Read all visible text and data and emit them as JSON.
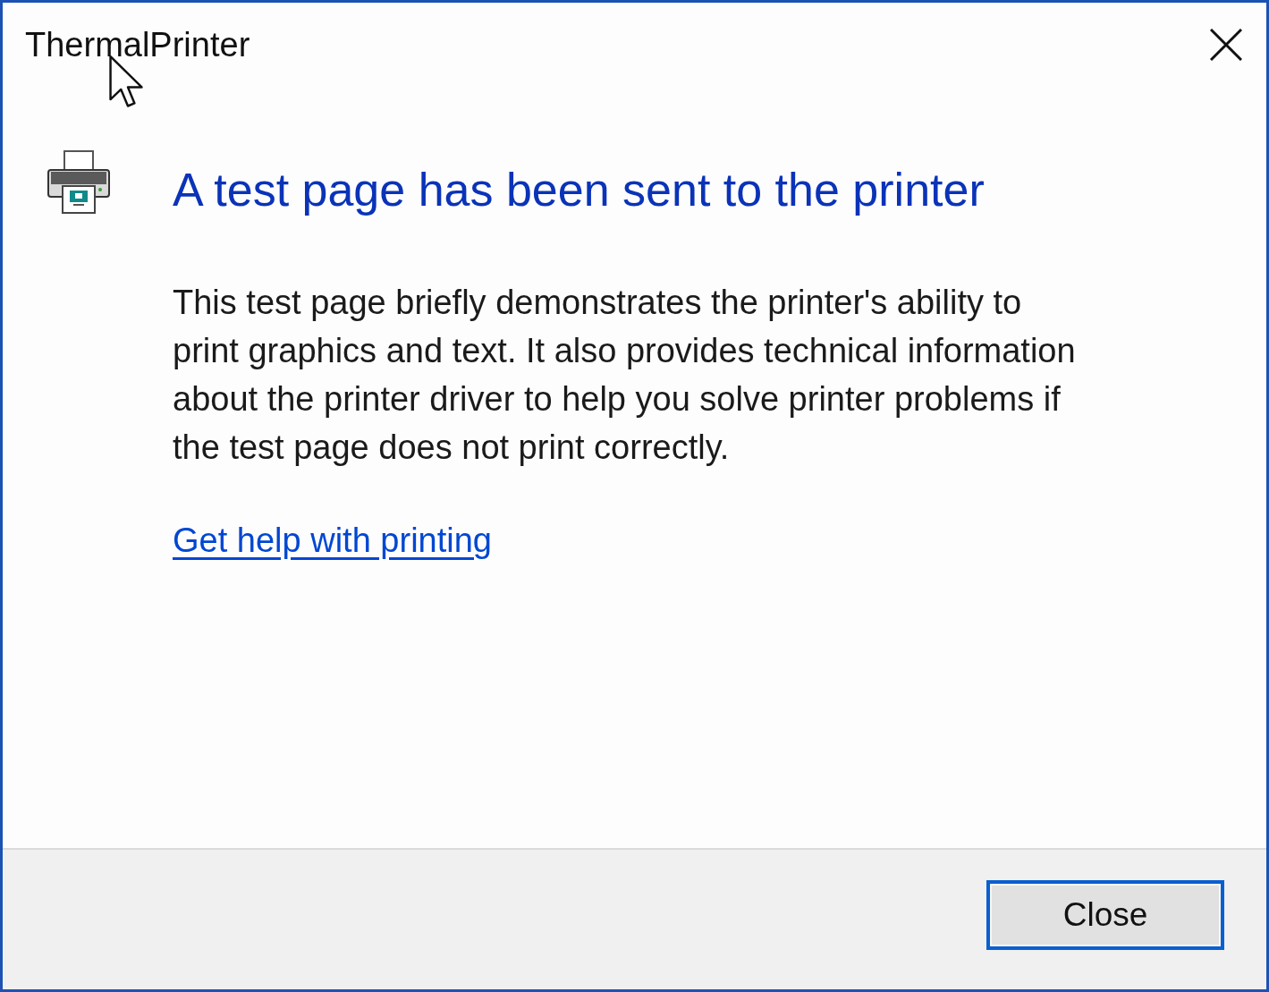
{
  "window": {
    "title": "ThermalPrinter"
  },
  "heading": "A test page has been sent to the printer",
  "body": "This test page briefly demonstrates the printer's ability to print graphics and text. It also provides technical information about the printer driver to help you solve printer problems if the test page does not print correctly.",
  "link": "Get help with printing",
  "buttons": [
    {
      "label": "Close",
      "focused": true
    }
  ]
}
